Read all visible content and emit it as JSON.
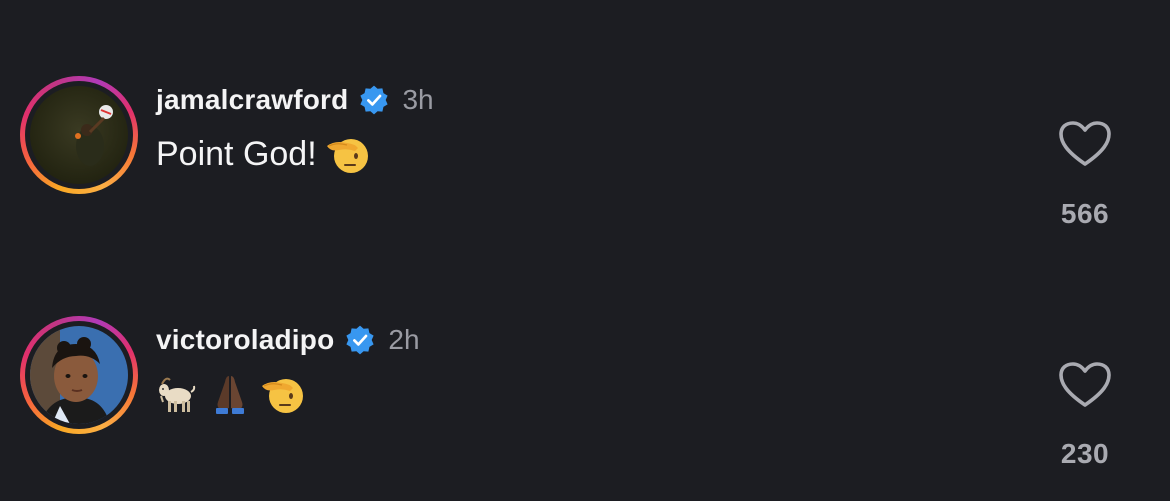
{
  "comments": [
    {
      "username": "jamalcrawford",
      "verified": true,
      "time": "3h",
      "text": "Point God!",
      "emojis": [
        "saluting-face"
      ],
      "likes": "566",
      "icons": {
        "verified": "verified-badge-icon",
        "like": "heart-outline-icon"
      }
    },
    {
      "username": "victoroladipo",
      "verified": true,
      "time": "2h",
      "text": "",
      "emojis": [
        "goat",
        "folded-hands",
        "saluting-face"
      ],
      "likes": "230",
      "icons": {
        "verified": "verified-badge-icon",
        "like": "heart-outline-icon"
      }
    }
  ],
  "colors": {
    "background": "#1c1d22",
    "verified_blue": "#3897f0",
    "muted_text": "#9a9ba3"
  }
}
